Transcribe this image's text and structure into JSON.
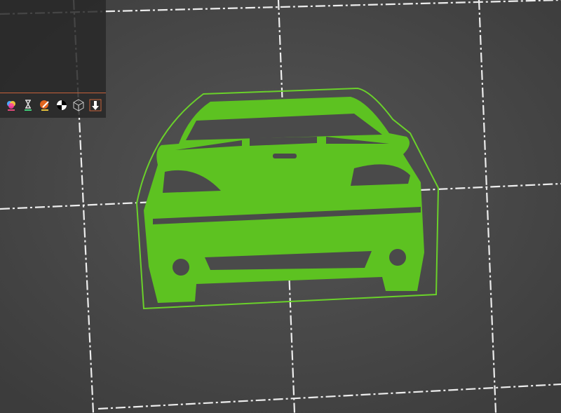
{
  "window": {
    "type": "3D slicer plater view"
  },
  "colors": {
    "background": "#4a4a4a",
    "grid_line": "#ffffff",
    "model": "#5dc221",
    "model_dark": "#4a9e1a",
    "brim_outline": "#6ad12a",
    "panel": "#2b2b2b",
    "panel_accent": "#c8623a"
  },
  "toolbar": {
    "items": [
      {
        "icon": "color-paint-icon",
        "label": ""
      },
      {
        "icon": "hourglass-icon",
        "label": ""
      },
      {
        "icon": "paint-brush-icon",
        "label": ""
      },
      {
        "icon": "seam-painting-icon",
        "label": ""
      },
      {
        "icon": "wireframe-cube-icon",
        "label": ""
      },
      {
        "icon": "drop-to-bed-icon",
        "label": ""
      }
    ]
  }
}
